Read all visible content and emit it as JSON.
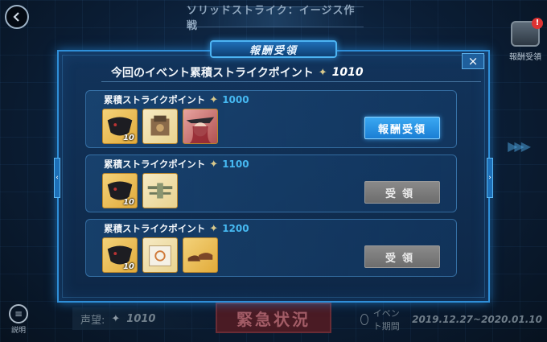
{
  "page_title": "ソリッドストライク：イージス作戦",
  "reward_corner_label": "報酬受領",
  "reward_corner_badge": "!",
  "help_label": "説明",
  "bottom": {
    "currency_label": "声望:",
    "currency_value": "1010",
    "emergency_button": "緊急状況",
    "period_label": "イベント期間",
    "period_dates": "2019.12.27~2020.01.10"
  },
  "modal": {
    "title": "報酬受領",
    "close": "×",
    "header_text": "今回のイベント累積ストライクポイント",
    "header_value": "1010",
    "rows": [
      {
        "label": "累積ストライクポイント",
        "points": "1000",
        "items": [
          {
            "icon": "black-mask-icon",
            "qty": "10"
          },
          {
            "icon": "shipgirl-cube-icon",
            "qty": ""
          },
          {
            "icon": "character-portrait-icon",
            "qty": ""
          }
        ],
        "button": "報酬受領",
        "button_state": "active"
      },
      {
        "label": "累積ストライクポイント",
        "points": "1100",
        "items": [
          {
            "icon": "black-mask-icon",
            "qty": "10"
          },
          {
            "icon": "biplane-icon",
            "qty": ""
          }
        ],
        "button": "受領",
        "button_state": "disabled"
      },
      {
        "label": "累積ストライクポイント",
        "points": "1200",
        "items": [
          {
            "icon": "black-mask-icon",
            "qty": "10"
          },
          {
            "icon": "box-icon",
            "qty": ""
          },
          {
            "icon": "shoes-icon",
            "qty": ""
          }
        ],
        "button": "受領",
        "button_state": "disabled"
      }
    ]
  },
  "colors": {
    "accent": "#2f8fd8",
    "points": "#46b9f2",
    "active_button": "#1a7ed4",
    "disabled_button": "#7a7a7a"
  }
}
